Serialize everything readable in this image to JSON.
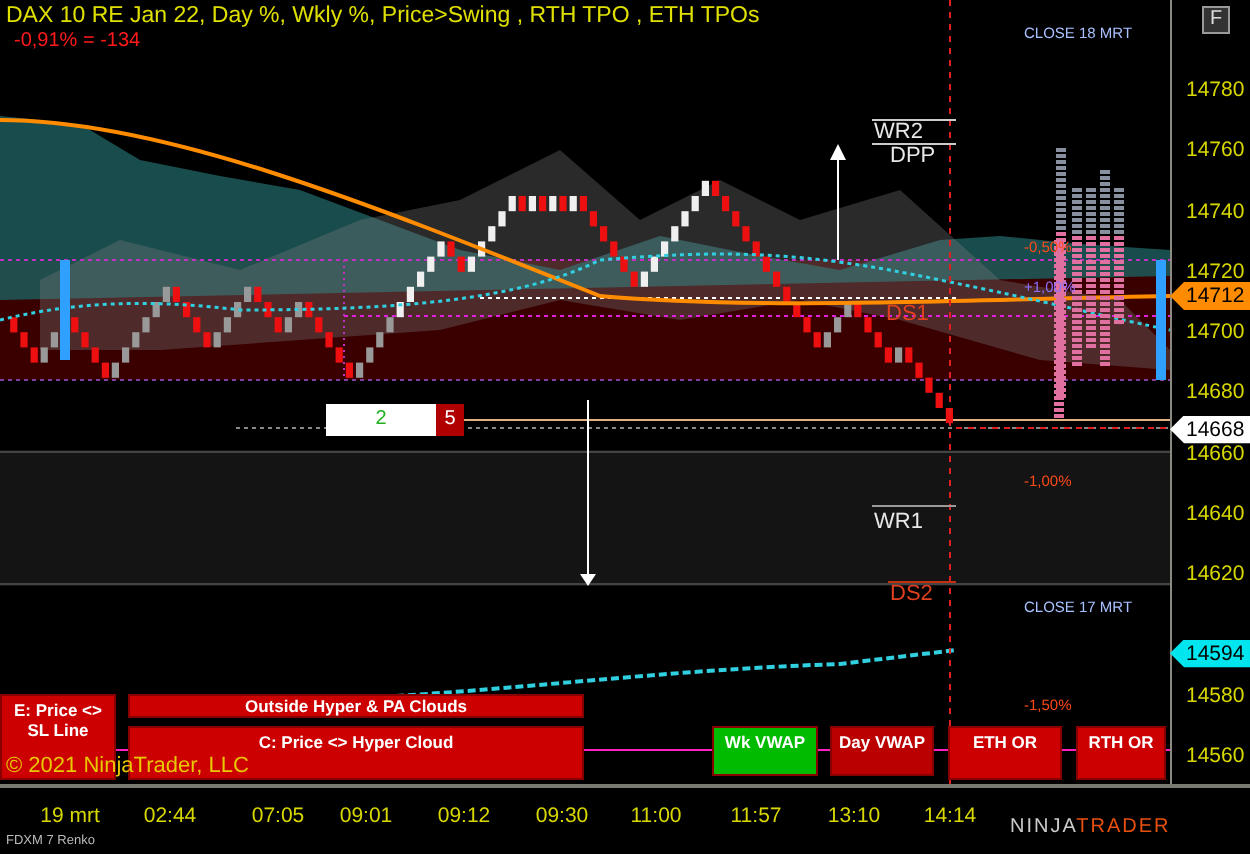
{
  "header": {
    "title": "DAX 10 RE Jan 22, Day %, Wkly %, Price>Swing  , RTH TPO , ETH TPOs",
    "change": "-0,91% = -134"
  },
  "corner_button": "F",
  "chart_labels": [
    {
      "text": "CLOSE 18 MRT",
      "kind": "close"
    },
    {
      "text": "WR2",
      "kind": "level"
    },
    {
      "text": "DPP",
      "kind": "level"
    },
    {
      "text": "-0,50%",
      "kind": "percent"
    },
    {
      "text": "+1,00%",
      "kind": "percent_up"
    },
    {
      "text": "DS1",
      "kind": "support"
    },
    {
      "text": "-1,00%",
      "kind": "percent"
    },
    {
      "text": "WR1",
      "kind": "level"
    },
    {
      "text": "DS2",
      "kind": "support"
    },
    {
      "text": "CLOSE 17 MRT",
      "kind": "close"
    },
    {
      "text": "-1,50%",
      "kind": "percent"
    }
  ],
  "counter": {
    "up": "2",
    "down": "5"
  },
  "signals": [
    {
      "text": "E: Price <> SL Line",
      "color": "#cc0000"
    },
    {
      "text": "Outside Hyper & PA Clouds",
      "color": "#cc0000"
    },
    {
      "text": "C: Price <> Hyper Cloud",
      "color": "#cc0000"
    },
    {
      "text": "Wk VWAP",
      "color": "#00bb00"
    },
    {
      "text": "Day VWAP",
      "color": "#bb0000"
    },
    {
      "text": "ETH OR",
      "color": "#cc0000"
    },
    {
      "text": "RTH OR",
      "color": "#cc0000"
    }
  ],
  "copyright": "© 2021 NinjaTrader, LLC",
  "price_axis": {
    "labels": [
      "14780",
      "14760",
      "14740",
      "14720",
      "14700",
      "14680",
      "14660",
      "14640",
      "14620",
      "14580",
      "14560"
    ]
  },
  "price_markers": [
    {
      "text": "14712",
      "color": "#ff8c00"
    },
    {
      "text": "14668",
      "color": "#ffffff"
    },
    {
      "text": "14594",
      "color": "#00e5ee"
    }
  ],
  "time_axis": {
    "labels": [
      "19 mrt",
      "02:44",
      "07:05",
      "09:01",
      "09:12",
      "09:30",
      "11:00",
      "11:57",
      "13:10",
      "14:14"
    ]
  },
  "footer": "FDXM 7 Renko",
  "logo": {
    "first": "NINJA",
    "second": "TRADER"
  }
}
